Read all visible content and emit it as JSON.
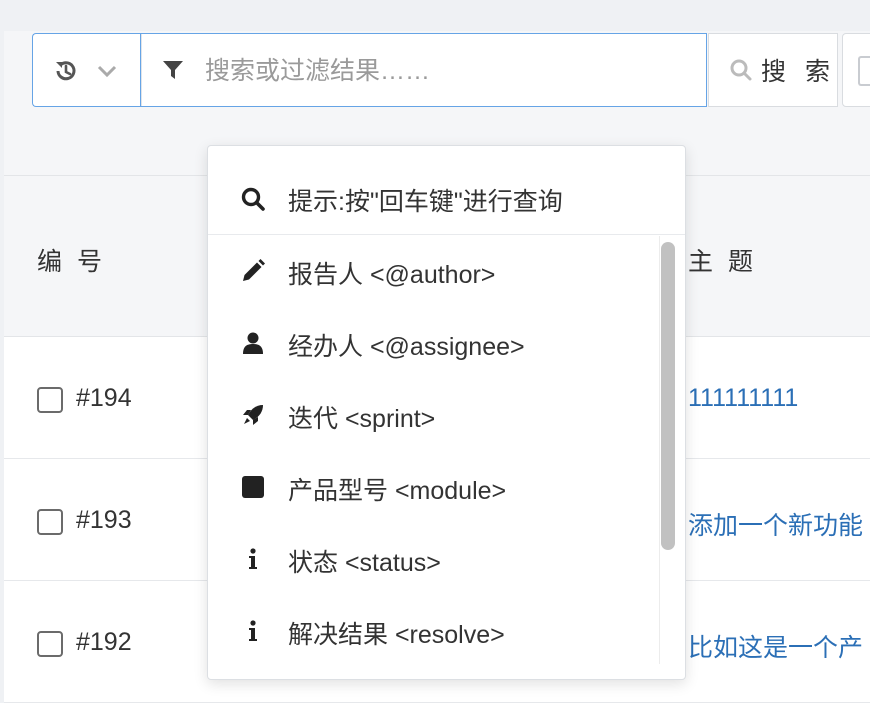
{
  "toolbar": {
    "search_placeholder": "搜索或过滤结果……",
    "search_button_label": "搜 索"
  },
  "table": {
    "headers": {
      "number": "编 号",
      "subject": "主 题"
    },
    "rows": [
      {
        "number": "#194",
        "subject": "111111111"
      },
      {
        "number": "#193",
        "subject": "添加一个新功能"
      },
      {
        "number": "#192",
        "subject": "比如这是一个产"
      }
    ]
  },
  "dropdown": {
    "hint": "提示:按\"回车键\"进行查询",
    "items": [
      {
        "label": "报告人 <@author>",
        "icon": "pencil-icon"
      },
      {
        "label": "经办人 <@assignee>",
        "icon": "user-icon"
      },
      {
        "label": "迭代 <sprint>",
        "icon": "rocket-icon"
      },
      {
        "label": "产品型号 <module>",
        "icon": "square-icon"
      },
      {
        "label": "状态 <status>",
        "icon": "info-icon"
      },
      {
        "label": "解决结果 <resolve>",
        "icon": "info-icon"
      }
    ]
  },
  "colors": {
    "accent_border": "#66a4e6",
    "link": "#2b6fb6"
  }
}
